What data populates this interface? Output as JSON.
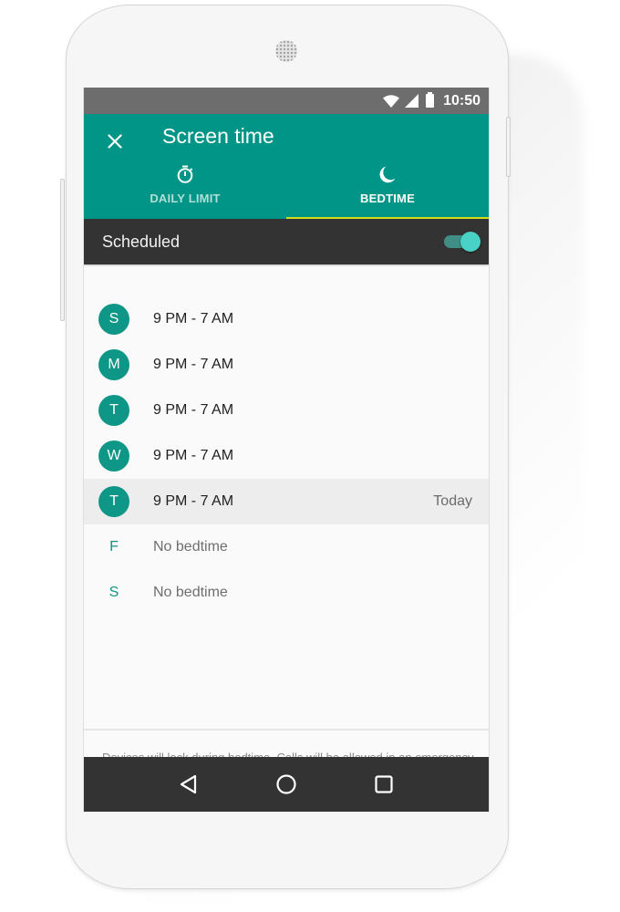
{
  "status_bar": {
    "time": "10:50",
    "icons": [
      "wifi-icon",
      "signal-icon",
      "battery-icon"
    ]
  },
  "app_bar": {
    "close_icon": "close-icon",
    "title": "Screen time"
  },
  "tabs": [
    {
      "label": "DAILY LIMIT",
      "icon": "stopwatch-icon",
      "active": false
    },
    {
      "label": "BEDTIME",
      "icon": "moon-icon",
      "active": true
    }
  ],
  "schedule": {
    "label": "Scheduled",
    "enabled": true
  },
  "days": [
    {
      "letter": "S",
      "time": "9 PM - 7 AM",
      "has_bedtime": true,
      "note": ""
    },
    {
      "letter": "M",
      "time": "9 PM - 7 AM",
      "has_bedtime": true,
      "note": ""
    },
    {
      "letter": "T",
      "time": "9 PM - 7 AM",
      "has_bedtime": true,
      "note": ""
    },
    {
      "letter": "W",
      "time": "9 PM - 7 AM",
      "has_bedtime": true,
      "note": ""
    },
    {
      "letter": "T",
      "time": "9 PM - 7 AM",
      "has_bedtime": true,
      "note": "Today"
    },
    {
      "letter": "F",
      "time": "No bedtime",
      "has_bedtime": false,
      "note": ""
    },
    {
      "letter": "S",
      "time": "No bedtime",
      "has_bedtime": false,
      "note": ""
    }
  ],
  "footer": {
    "text": "Devices will lock during bedtime. Calls will be allowed in an emergency."
  },
  "nav_bar": {
    "buttons": [
      "back-icon",
      "home-icon",
      "recents-icon"
    ]
  },
  "colors": {
    "primary": "#009586",
    "avatar": "#0e9786",
    "tab_indicator": "#d7e11b",
    "dark_bar": "#333333",
    "status_bar": "#6d6d6d",
    "toggle_thumb": "#48d1c4"
  }
}
